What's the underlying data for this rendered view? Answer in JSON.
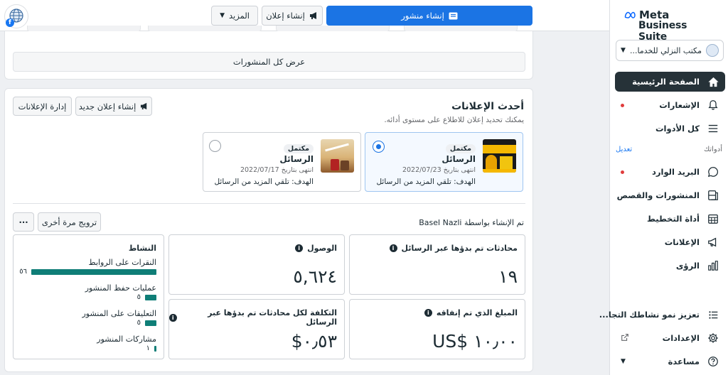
{
  "corner_avatar": {
    "icon": "globe-icon",
    "badge_icon": "facebook-icon"
  },
  "topbar": {
    "create_post": "إنشاء منشور",
    "create_ad": "إنشاء إعلان",
    "more": "المزيد"
  },
  "sidebar": {
    "logo_meta": "Meta",
    "logo_suite": "Business Suite",
    "account_name": "مكتب النزلي للخدما...",
    "nav": [
      {
        "label": "الصفحة الرئيسية",
        "icon": "home-icon"
      },
      {
        "label": "الإشعارات",
        "icon": "bell-icon"
      },
      {
        "label": "كل الأدوات",
        "icon": "menu-icon"
      }
    ],
    "tools_heading": "أدواتك",
    "tools_edit": "تعديل",
    "tools": [
      {
        "label": "البريد الوارد",
        "icon": "chat-icon"
      },
      {
        "label": "المنشورات والقصص",
        "icon": "posts-icon"
      },
      {
        "label": "أداة التخطيط",
        "icon": "calendar-icon"
      },
      {
        "label": "الإعلانات",
        "icon": "megaphone-icon"
      },
      {
        "label": "الرؤى",
        "icon": "insights-icon"
      }
    ],
    "bottom": [
      {
        "label": "تعزيز نمو نشاطك التجا...",
        "icon": "list-icon"
      },
      {
        "label": "الإعدادات",
        "icon": "gear-icon"
      },
      {
        "label": "مساعدة",
        "icon": "help-icon"
      }
    ]
  },
  "posts": {
    "view_all": "عرض كل المنشورات"
  },
  "ads": {
    "title": "أحدث الإعلانات",
    "subtitle": "يمكنك تحديد إعلان للاطلاع على مستوى أدائه.",
    "new_ad": "إنشاء إعلان جديد",
    "manage_ads": "إدارة الإعلانات",
    "cards": [
      {
        "status": "مكتمل",
        "name": "الرسائل",
        "date": "انتهى بتاريخ 2022/07/23",
        "goal": "الهدف: تلقي المزيد من الرسائل",
        "selected": true
      },
      {
        "status": "مكتمل",
        "name": "الرسائل",
        "date": "انتهى بتاريخ 2022/07/17",
        "goal": "الهدف: تلقي المزيد من الرسائل",
        "selected": false
      }
    ],
    "created_by": "تم الإنشاء بواسطة Basel Nazli",
    "boost_again": "ترويج مرة أخرى",
    "more_dots": "···",
    "metrics": {
      "conversations": {
        "label": "محادثات تم بدؤها عبر الرسائل",
        "value": "١٩"
      },
      "reach": {
        "label": "الوصول",
        "value": "٥,٦٢٤"
      },
      "spent": {
        "label": "المبلغ الذي تم إنفاقه",
        "value": "US$ ١٠٫٠٠"
      },
      "cost_per": {
        "label": "التكلفة لكل محادثات تم بدؤها عبر الرسائل",
        "value": "$٠٫٥٣"
      }
    },
    "activity": {
      "title": "النشاط",
      "max": 56,
      "items": [
        {
          "label": "النقرات على الروابط",
          "value": 56,
          "display": "٥٦"
        },
        {
          "label": "عمليات حفظ المنشور",
          "value": 5,
          "display": "٥"
        },
        {
          "label": "التعليقات على المنشور",
          "value": 5,
          "display": "٥"
        },
        {
          "label": "مشاركات المنشور",
          "value": 1,
          "display": "١"
        }
      ]
    }
  },
  "colors": {
    "accent": "#1b74e4",
    "bar": "#0f7e77",
    "active_nav": "#263238",
    "notif_dot": "#e03c3c"
  }
}
